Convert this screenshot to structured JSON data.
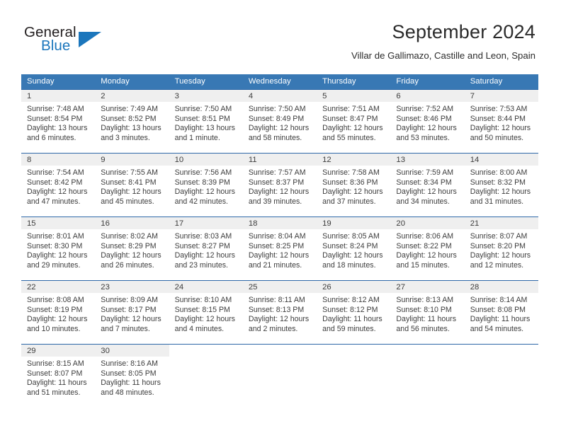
{
  "brand": {
    "word1": "General",
    "word2": "Blue",
    "accent_color": "#1b76bc",
    "logo_icon": "triangle-logo-icon"
  },
  "header": {
    "title": "September 2024",
    "location": "Villar de Gallimazo, Castille and Leon, Spain"
  },
  "colors": {
    "header_blue": "#3878b4",
    "row_divider": "#2e68a8",
    "daynum_strip": "#efefef",
    "text": "#3d3d3d"
  },
  "weekday_headers": [
    "Sunday",
    "Monday",
    "Tuesday",
    "Wednesday",
    "Thursday",
    "Friday",
    "Saturday"
  ],
  "weeks": [
    [
      {
        "day": "1",
        "sunrise": "Sunrise: 7:48 AM",
        "sunset": "Sunset: 8:54 PM",
        "daylight1": "Daylight: 13 hours",
        "daylight2": "and 6 minutes."
      },
      {
        "day": "2",
        "sunrise": "Sunrise: 7:49 AM",
        "sunset": "Sunset: 8:52 PM",
        "daylight1": "Daylight: 13 hours",
        "daylight2": "and 3 minutes."
      },
      {
        "day": "3",
        "sunrise": "Sunrise: 7:50 AM",
        "sunset": "Sunset: 8:51 PM",
        "daylight1": "Daylight: 13 hours",
        "daylight2": "and 1 minute."
      },
      {
        "day": "4",
        "sunrise": "Sunrise: 7:50 AM",
        "sunset": "Sunset: 8:49 PM",
        "daylight1": "Daylight: 12 hours",
        "daylight2": "and 58 minutes."
      },
      {
        "day": "5",
        "sunrise": "Sunrise: 7:51 AM",
        "sunset": "Sunset: 8:47 PM",
        "daylight1": "Daylight: 12 hours",
        "daylight2": "and 55 minutes."
      },
      {
        "day": "6",
        "sunrise": "Sunrise: 7:52 AM",
        "sunset": "Sunset: 8:46 PM",
        "daylight1": "Daylight: 12 hours",
        "daylight2": "and 53 minutes."
      },
      {
        "day": "7",
        "sunrise": "Sunrise: 7:53 AM",
        "sunset": "Sunset: 8:44 PM",
        "daylight1": "Daylight: 12 hours",
        "daylight2": "and 50 minutes."
      }
    ],
    [
      {
        "day": "8",
        "sunrise": "Sunrise: 7:54 AM",
        "sunset": "Sunset: 8:42 PM",
        "daylight1": "Daylight: 12 hours",
        "daylight2": "and 47 minutes."
      },
      {
        "day": "9",
        "sunrise": "Sunrise: 7:55 AM",
        "sunset": "Sunset: 8:41 PM",
        "daylight1": "Daylight: 12 hours",
        "daylight2": "and 45 minutes."
      },
      {
        "day": "10",
        "sunrise": "Sunrise: 7:56 AM",
        "sunset": "Sunset: 8:39 PM",
        "daylight1": "Daylight: 12 hours",
        "daylight2": "and 42 minutes."
      },
      {
        "day": "11",
        "sunrise": "Sunrise: 7:57 AM",
        "sunset": "Sunset: 8:37 PM",
        "daylight1": "Daylight: 12 hours",
        "daylight2": "and 39 minutes."
      },
      {
        "day": "12",
        "sunrise": "Sunrise: 7:58 AM",
        "sunset": "Sunset: 8:36 PM",
        "daylight1": "Daylight: 12 hours",
        "daylight2": "and 37 minutes."
      },
      {
        "day": "13",
        "sunrise": "Sunrise: 7:59 AM",
        "sunset": "Sunset: 8:34 PM",
        "daylight1": "Daylight: 12 hours",
        "daylight2": "and 34 minutes."
      },
      {
        "day": "14",
        "sunrise": "Sunrise: 8:00 AM",
        "sunset": "Sunset: 8:32 PM",
        "daylight1": "Daylight: 12 hours",
        "daylight2": "and 31 minutes."
      }
    ],
    [
      {
        "day": "15",
        "sunrise": "Sunrise: 8:01 AM",
        "sunset": "Sunset: 8:30 PM",
        "daylight1": "Daylight: 12 hours",
        "daylight2": "and 29 minutes."
      },
      {
        "day": "16",
        "sunrise": "Sunrise: 8:02 AM",
        "sunset": "Sunset: 8:29 PM",
        "daylight1": "Daylight: 12 hours",
        "daylight2": "and 26 minutes."
      },
      {
        "day": "17",
        "sunrise": "Sunrise: 8:03 AM",
        "sunset": "Sunset: 8:27 PM",
        "daylight1": "Daylight: 12 hours",
        "daylight2": "and 23 minutes."
      },
      {
        "day": "18",
        "sunrise": "Sunrise: 8:04 AM",
        "sunset": "Sunset: 8:25 PM",
        "daylight1": "Daylight: 12 hours",
        "daylight2": "and 21 minutes."
      },
      {
        "day": "19",
        "sunrise": "Sunrise: 8:05 AM",
        "sunset": "Sunset: 8:24 PM",
        "daylight1": "Daylight: 12 hours",
        "daylight2": "and 18 minutes."
      },
      {
        "day": "20",
        "sunrise": "Sunrise: 8:06 AM",
        "sunset": "Sunset: 8:22 PM",
        "daylight1": "Daylight: 12 hours",
        "daylight2": "and 15 minutes."
      },
      {
        "day": "21",
        "sunrise": "Sunrise: 8:07 AM",
        "sunset": "Sunset: 8:20 PM",
        "daylight1": "Daylight: 12 hours",
        "daylight2": "and 12 minutes."
      }
    ],
    [
      {
        "day": "22",
        "sunrise": "Sunrise: 8:08 AM",
        "sunset": "Sunset: 8:19 PM",
        "daylight1": "Daylight: 12 hours",
        "daylight2": "and 10 minutes."
      },
      {
        "day": "23",
        "sunrise": "Sunrise: 8:09 AM",
        "sunset": "Sunset: 8:17 PM",
        "daylight1": "Daylight: 12 hours",
        "daylight2": "and 7 minutes."
      },
      {
        "day": "24",
        "sunrise": "Sunrise: 8:10 AM",
        "sunset": "Sunset: 8:15 PM",
        "daylight1": "Daylight: 12 hours",
        "daylight2": "and 4 minutes."
      },
      {
        "day": "25",
        "sunrise": "Sunrise: 8:11 AM",
        "sunset": "Sunset: 8:13 PM",
        "daylight1": "Daylight: 12 hours",
        "daylight2": "and 2 minutes."
      },
      {
        "day": "26",
        "sunrise": "Sunrise: 8:12 AM",
        "sunset": "Sunset: 8:12 PM",
        "daylight1": "Daylight: 11 hours",
        "daylight2": "and 59 minutes."
      },
      {
        "day": "27",
        "sunrise": "Sunrise: 8:13 AM",
        "sunset": "Sunset: 8:10 PM",
        "daylight1": "Daylight: 11 hours",
        "daylight2": "and 56 minutes."
      },
      {
        "day": "28",
        "sunrise": "Sunrise: 8:14 AM",
        "sunset": "Sunset: 8:08 PM",
        "daylight1": "Daylight: 11 hours",
        "daylight2": "and 54 minutes."
      }
    ],
    [
      {
        "day": "29",
        "sunrise": "Sunrise: 8:15 AM",
        "sunset": "Sunset: 8:07 PM",
        "daylight1": "Daylight: 11 hours",
        "daylight2": "and 51 minutes."
      },
      {
        "day": "30",
        "sunrise": "Sunrise: 8:16 AM",
        "sunset": "Sunset: 8:05 PM",
        "daylight1": "Daylight: 11 hours",
        "daylight2": "and 48 minutes."
      },
      {
        "day": "",
        "sunrise": "",
        "sunset": "",
        "daylight1": "",
        "daylight2": ""
      },
      {
        "day": "",
        "sunrise": "",
        "sunset": "",
        "daylight1": "",
        "daylight2": ""
      },
      {
        "day": "",
        "sunrise": "",
        "sunset": "",
        "daylight1": "",
        "daylight2": ""
      },
      {
        "day": "",
        "sunrise": "",
        "sunset": "",
        "daylight1": "",
        "daylight2": ""
      },
      {
        "day": "",
        "sunrise": "",
        "sunset": "",
        "daylight1": "",
        "daylight2": ""
      }
    ]
  ]
}
